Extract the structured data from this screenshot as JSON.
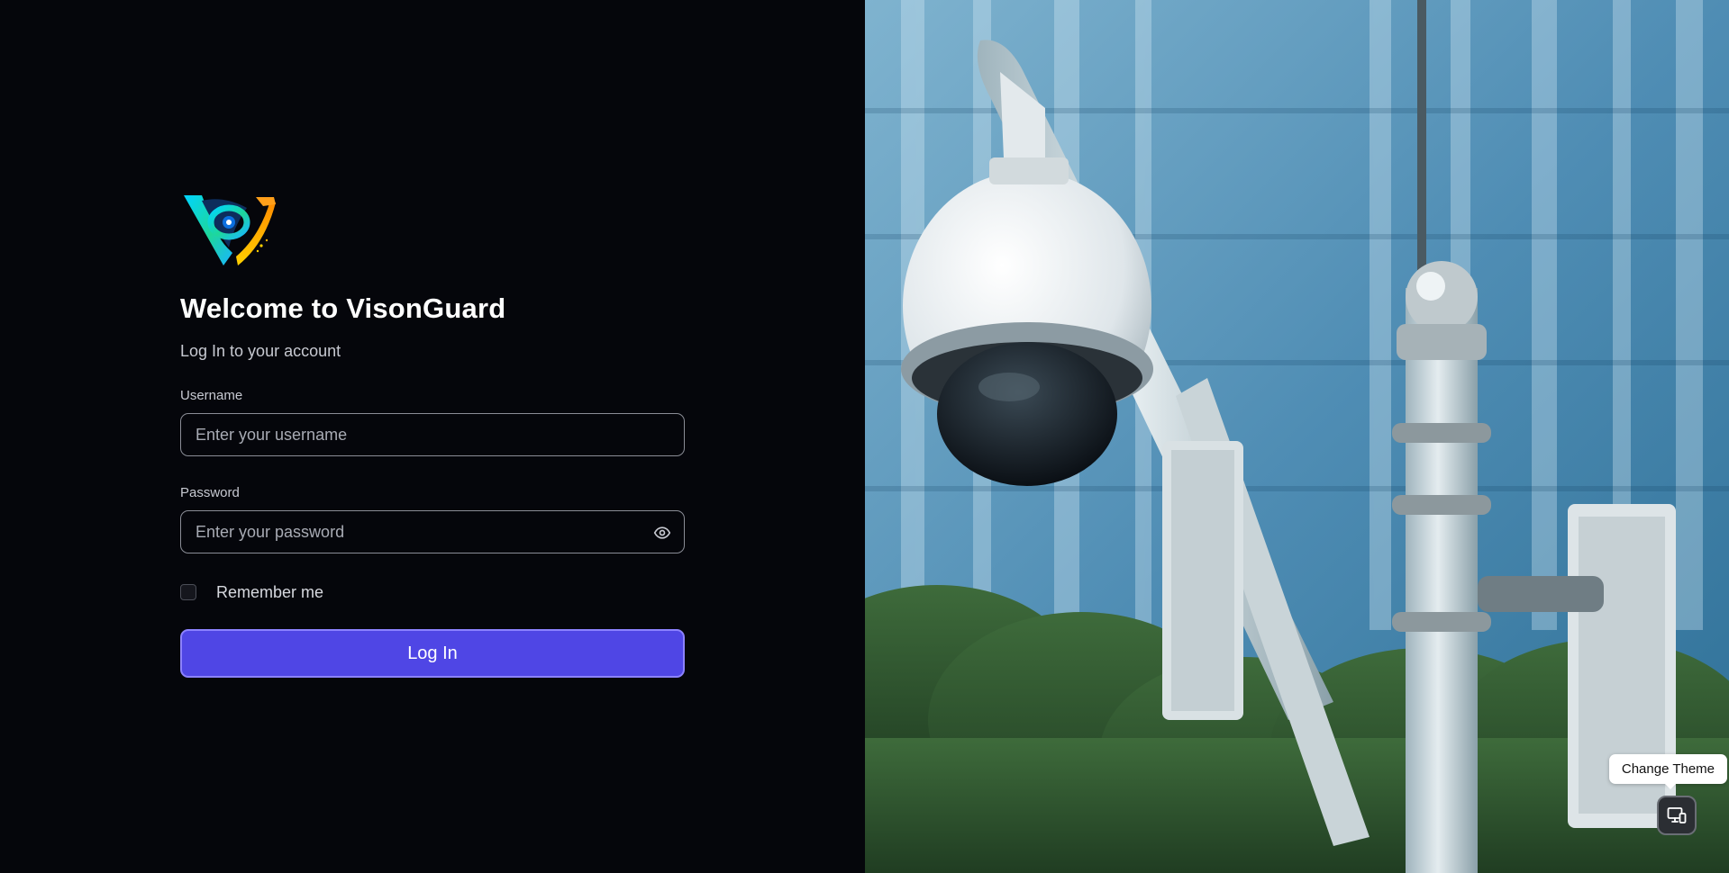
{
  "app": {
    "name": "VisonGuard"
  },
  "login": {
    "logo_icon": "visionguard-eye-shield-logo",
    "title": "Welcome to VisonGuard",
    "subtitle": "Log In to your account",
    "username": {
      "label": "Username",
      "value": "",
      "placeholder": "Enter your username"
    },
    "password": {
      "label": "Password",
      "value": "",
      "placeholder": "Enter your password",
      "toggle_icon": "eye-icon"
    },
    "remember_me": {
      "label": "Remember me",
      "checked": false
    },
    "submit_label": "Log In"
  },
  "hero": {
    "image": "security-dome-camera-on-pole-photo"
  },
  "theme_toggle": {
    "tooltip": "Change Theme",
    "icon": "monitor-phone-icon"
  },
  "colors": {
    "background": "#05060b",
    "accent": "#4f46e5",
    "accent_border": "#8c82ff",
    "input_border": "#8a8d96"
  }
}
